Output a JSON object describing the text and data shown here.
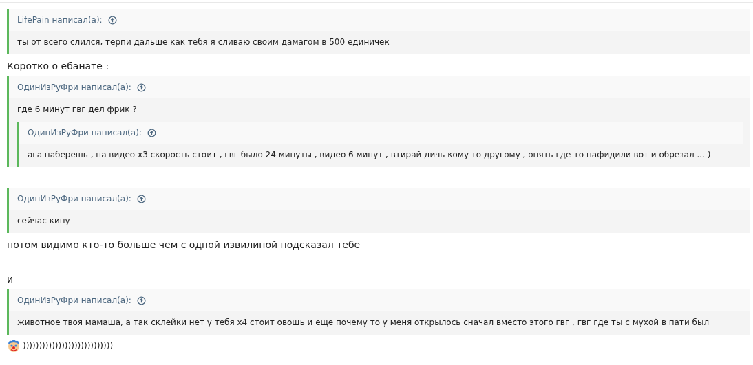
{
  "post": [
    {
      "kind": "quote",
      "author": "LifePain написал(а):",
      "body": [
        {
          "kind": "text",
          "text": "ты от всего слился, терпи дальше как тебя я сливаю своим дамагом в 500 единичек"
        }
      ]
    },
    {
      "kind": "text",
      "text": "Коротко о ебанате :"
    },
    {
      "kind": "quote",
      "author": "ОдинИзРуФри написал(а):",
      "body": [
        {
          "kind": "text",
          "text": "где 6 минут гвг дел фрик ?"
        },
        {
          "kind": "quote",
          "author": "ОдинИзРуФри написал(а):",
          "body": [
            {
              "kind": "text",
              "text": "ага наберешь , на видео х3 скорость стоит , гвг было 24 минуты , видео 6 минут , втирай дичь кому то другому , опять где-то нафидили вот и обрезал ... )"
            }
          ]
        }
      ]
    },
    {
      "kind": "blank"
    },
    {
      "kind": "quote",
      "author": "ОдинИзРуФри написал(а):",
      "body": [
        {
          "kind": "text",
          "text": "сейчас кину"
        }
      ]
    },
    {
      "kind": "text",
      "text": "потом видимо кто-то больше чем с одной извилиной подсказал тебе"
    },
    {
      "kind": "blank"
    },
    {
      "kind": "text",
      "text": "и"
    },
    {
      "kind": "quote",
      "author": "ОдинИзРуФри написал(а):",
      "body": [
        {
          "kind": "text",
          "text": "животное твоя мамаша, а так склейки нет у тебя х4 стоит овощь и еще почему то у меня открылось сначал вместо этого гвг , гвг где ты с мухой в пати был"
        }
      ]
    },
    {
      "kind": "emoji",
      "text": "))))))))))))))))))))))))))))"
    }
  ]
}
